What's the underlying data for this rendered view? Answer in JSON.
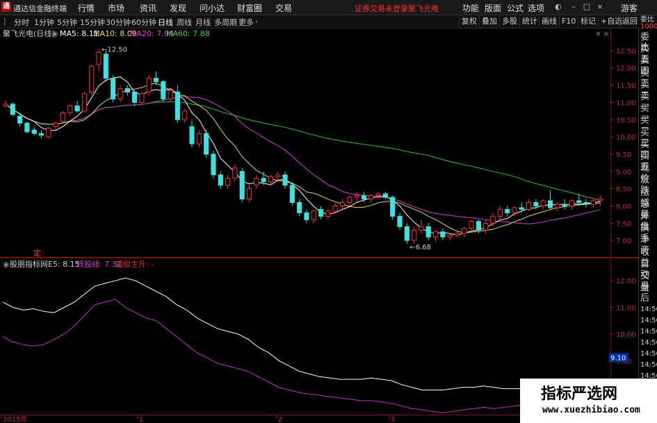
{
  "menubar": {
    "logo": "通",
    "app_title": "通达信金融终端",
    "items": [
      "行情",
      "市场",
      "资讯",
      "发现",
      "问小达",
      "财富圈",
      "交易"
    ],
    "status": "证券交易未登录",
    "stock": "聚飞光电",
    "right_items": [
      "功能",
      "版面",
      "公式",
      "选项"
    ],
    "user": "游客"
  },
  "toolbar": {
    "periods": [
      "分时",
      "1分钟",
      "5分钟",
      "15分钟",
      "30分钟",
      "60分钟",
      "日线",
      "周线",
      "月线",
      "多周期",
      "更多"
    ],
    "active_period": "日线",
    "right_buttons": [
      "复权",
      "叠加",
      "多股",
      "统计",
      "画线",
      "F10",
      "标记",
      "+自选",
      "返回"
    ]
  },
  "main_chart": {
    "legend_name": "聚飞光电(日线)",
    "ma": [
      {
        "label": "MA5: 8.11",
        "color": "#ffffff"
      },
      {
        "label": "MA10: 8.09",
        "color": "#e8e060"
      },
      {
        "label": "MA20: 7.98",
        "color": "#e040e0"
      },
      {
        "label": "MA60: 7.88",
        "color": "#40d040"
      }
    ],
    "high_label": "12.50",
    "low_label": "6.68",
    "y_ticks": [
      "12.50",
      "12.00",
      "11.50",
      "11.00",
      "10.50",
      "10.00",
      "9.50",
      "9.00",
      "8.50",
      "8.00",
      "7.50",
      "7.00"
    ],
    "marker": "定"
  },
  "sub_chart": {
    "indicator": "股朋指标网",
    "e5": "E5: 8.15",
    "line2": "妖股线: 7.32",
    "line3": "超级主升: -",
    "y_ticks": [
      "12.00",
      "11.00",
      "10.00",
      "9.00",
      "8.00"
    ],
    "cursor_value": "9.10"
  },
  "x_axis": [
    "2015年",
    "1",
    "2",
    "3"
  ],
  "right_panel": {
    "top_small": [
      "委比",
      "1000"
    ],
    "labels": [
      "委比",
      "卖五",
      "卖四",
      "卖三",
      "卖二",
      "卖一",
      "买一",
      "买二",
      "买三",
      "买四",
      "买五",
      "现价",
      "涨跌",
      "涨幅",
      "总量",
      "外盘",
      "换手",
      "净资",
      "收益",
      "自动",
      "交易",
      "盘后"
    ],
    "times": [
      "14:56",
      "14:56",
      "14:56",
      "14:56",
      "14:56",
      "14:56",
      "14:56",
      "14:56"
    ]
  },
  "watermark": {
    "title": "指标严选网",
    "url": "www.xuezhibiao.com"
  },
  "chart_data": {
    "type": "candlestick",
    "ylim": [
      6.5,
      12.8
    ],
    "candles": [
      [
        10.9,
        11.05,
        10.85,
        10.95
      ],
      [
        10.95,
        11.0,
        10.6,
        10.65
      ],
      [
        10.6,
        10.7,
        10.3,
        10.4
      ],
      [
        10.4,
        10.45,
        10.1,
        10.15
      ],
      [
        10.2,
        10.3,
        10.05,
        10.1
      ],
      [
        10.1,
        10.2,
        9.95,
        10.05
      ],
      [
        10.0,
        10.3,
        9.95,
        10.25
      ],
      [
        10.3,
        10.45,
        10.2,
        10.4
      ],
      [
        10.45,
        10.75,
        10.4,
        10.7
      ],
      [
        10.7,
        10.95,
        10.6,
        10.9
      ],
      [
        10.9,
        11.05,
        10.7,
        10.75
      ],
      [
        10.75,
        11.3,
        10.7,
        11.25
      ],
      [
        11.3,
        12.1,
        11.2,
        12.05
      ],
      [
        12.1,
        12.55,
        11.9,
        12.45
      ],
      [
        12.4,
        12.5,
        11.6,
        11.7
      ],
      [
        11.7,
        11.8,
        11.0,
        11.1
      ],
      [
        11.1,
        11.5,
        11.0,
        11.4
      ],
      [
        11.4,
        11.5,
        11.2,
        11.3
      ],
      [
        11.3,
        11.35,
        10.9,
        11.0
      ],
      [
        11.0,
        11.3,
        10.95,
        11.25
      ],
      [
        11.3,
        11.8,
        11.2,
        11.7
      ],
      [
        11.7,
        11.9,
        11.5,
        11.6
      ],
      [
        11.6,
        11.65,
        11.0,
        11.1
      ],
      [
        11.1,
        11.4,
        11.0,
        11.35
      ],
      [
        11.3,
        11.5,
        10.4,
        10.5
      ],
      [
        10.5,
        10.8,
        10.4,
        10.75
      ],
      [
        10.3,
        10.5,
        9.7,
        9.8
      ],
      [
        9.8,
        10.2,
        9.7,
        10.1
      ],
      [
        10.1,
        10.2,
        9.4,
        9.5
      ],
      [
        9.5,
        9.6,
        8.8,
        8.9
      ],
      [
        8.9,
        9.0,
        8.5,
        8.6
      ],
      [
        8.6,
        8.9,
        8.5,
        8.8
      ],
      [
        8.8,
        9.2,
        8.7,
        9.1
      ],
      [
        9.0,
        9.1,
        8.1,
        8.2
      ],
      [
        8.2,
        8.6,
        8.1,
        8.5
      ],
      [
        8.6,
        8.9,
        8.5,
        8.8
      ],
      [
        8.8,
        9.0,
        8.6,
        8.7
      ],
      [
        8.7,
        8.9,
        8.6,
        8.85
      ],
      [
        8.85,
        9.0,
        8.7,
        8.9
      ],
      [
        8.9,
        9.0,
        8.5,
        8.6
      ],
      [
        8.6,
        8.7,
        8.0,
        8.1
      ],
      [
        8.1,
        8.2,
        7.7,
        7.8
      ],
      [
        7.8,
        7.9,
        7.5,
        7.6
      ],
      [
        7.6,
        7.9,
        7.5,
        7.85
      ],
      [
        7.9,
        8.0,
        7.6,
        7.7
      ],
      [
        7.7,
        7.9,
        7.6,
        7.85
      ],
      [
        7.85,
        8.1,
        7.8,
        8.0
      ],
      [
        8.0,
        8.2,
        7.9,
        8.1
      ],
      [
        8.1,
        8.3,
        8.0,
        8.25
      ],
      [
        8.25,
        8.4,
        8.1,
        8.3
      ],
      [
        8.3,
        8.4,
        8.1,
        8.2
      ],
      [
        8.2,
        8.35,
        8.1,
        8.3
      ],
      [
        8.3,
        8.4,
        8.2,
        8.35
      ],
      [
        8.35,
        8.4,
        8.2,
        8.25
      ],
      [
        8.25,
        8.3,
        7.6,
        7.7
      ],
      [
        7.7,
        7.8,
        7.3,
        7.4
      ],
      [
        7.4,
        7.5,
        6.9,
        7.0
      ],
      [
        7.0,
        7.4,
        6.9,
        7.3
      ],
      [
        7.3,
        7.6,
        7.2,
        7.4
      ],
      [
        7.4,
        7.5,
        7.0,
        7.1
      ],
      [
        7.1,
        7.3,
        6.95,
        7.25
      ],
      [
        7.25,
        7.35,
        7.0,
        7.1
      ],
      [
        7.1,
        7.2,
        7.0,
        7.15
      ],
      [
        7.15,
        7.3,
        7.1,
        7.2
      ],
      [
        7.2,
        7.4,
        7.1,
        7.35
      ],
      [
        7.35,
        7.6,
        7.3,
        7.55
      ],
      [
        7.55,
        7.6,
        7.2,
        7.3
      ],
      [
        7.3,
        7.6,
        7.2,
        7.5
      ],
      [
        7.5,
        7.8,
        7.4,
        7.7
      ],
      [
        7.7,
        8.0,
        7.6,
        7.9
      ],
      [
        7.9,
        8.0,
        7.7,
        7.8
      ],
      [
        7.8,
        8.0,
        7.7,
        7.95
      ],
      [
        7.95,
        8.1,
        7.8,
        7.9
      ],
      [
        7.9,
        8.2,
        7.85,
        8.1
      ],
      [
        8.1,
        8.2,
        7.9,
        8.0
      ],
      [
        8.0,
        8.2,
        7.9,
        8.15
      ],
      [
        8.15,
        8.45,
        7.9,
        7.95
      ],
      [
        7.95,
        8.1,
        7.85,
        8.05
      ],
      [
        8.05,
        8.2,
        7.9,
        8.0
      ],
      [
        8.0,
        8.2,
        7.9,
        8.15
      ],
      [
        8.15,
        8.35,
        8.0,
        8.1
      ],
      [
        8.1,
        8.2,
        7.95,
        8.05
      ],
      [
        8.05,
        8.2,
        7.95,
        8.15
      ],
      [
        8.15,
        8.3,
        8.0,
        8.2
      ]
    ],
    "sub_series": {
      "e5": [
        11.2,
        11.0,
        10.9,
        10.95,
        10.85,
        10.8,
        11.0,
        11.2,
        11.5,
        11.8,
        11.9,
        12.0,
        12.1,
        12.0,
        11.8,
        11.6,
        11.4,
        11.1,
        10.9,
        10.6,
        10.4,
        10.2,
        10.1,
        10.0,
        9.8,
        9.5,
        9.3,
        9.0,
        8.8,
        8.6,
        8.5,
        8.4,
        8.35,
        8.3,
        8.3,
        8.3,
        8.35,
        8.3,
        8.25,
        8.1,
        8.0,
        7.9,
        7.9,
        7.9,
        7.95,
        8.0,
        8.0,
        8.05,
        8.0,
        7.95,
        7.95,
        7.95,
        7.9,
        7.9,
        7.95,
        8.05,
        8.15,
        8.2,
        8.25,
        8.15
      ],
      "yao": [
        9.9,
        9.7,
        9.6,
        9.55,
        9.6,
        9.8,
        10.0,
        10.3,
        10.7,
        11.1,
        11.2,
        11.3,
        11.0,
        10.8,
        10.6,
        10.5,
        10.2,
        9.9,
        9.6,
        9.3,
        9.1,
        8.9,
        8.8,
        8.7,
        8.6,
        8.4,
        8.2,
        8.0,
        7.9,
        7.8,
        7.75,
        7.7,
        7.65,
        7.6,
        7.55,
        7.5,
        7.5,
        7.45,
        7.4,
        7.3,
        7.2,
        7.15,
        7.1,
        7.05,
        7.1,
        7.15,
        7.2,
        7.25,
        7.2,
        7.25,
        7.3,
        7.35,
        7.3,
        7.35,
        7.4,
        7.45,
        7.55,
        7.65,
        7.6,
        7.55
      ]
    },
    "sub_ylim": [
      7.0,
      12.5
    ]
  }
}
